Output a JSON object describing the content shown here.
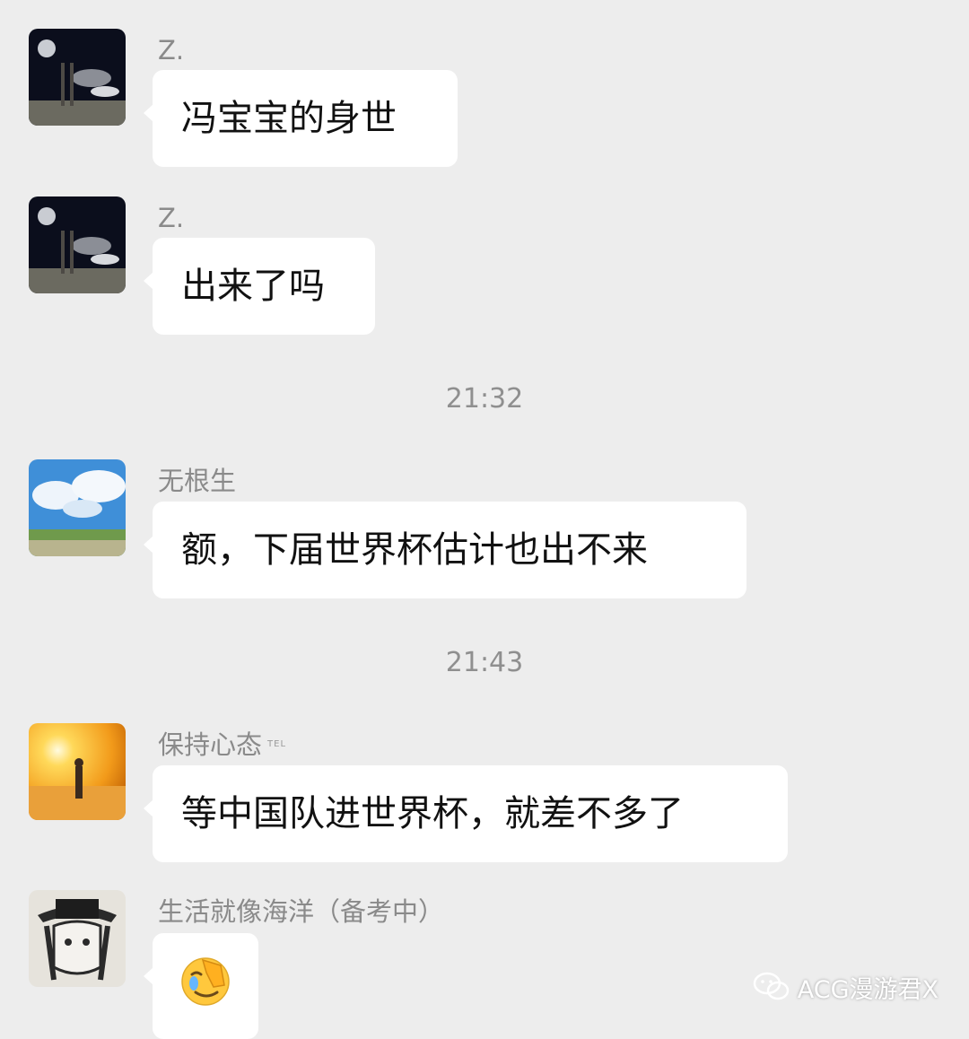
{
  "messages": [
    {
      "sender": "Z.",
      "text": "冯宝宝的身世"
    },
    {
      "sender": "Z.",
      "text": "出来了吗"
    },
    {
      "sender": "无根生",
      "text": "额，下届世界杯估计也出不来"
    },
    {
      "sender": "保持心态",
      "sender_tag": "TEL",
      "text": "等中国队进世界杯，就差不多了"
    },
    {
      "sender": "生活就像海洋（备考中）",
      "emoji": "facepalm-emoji"
    }
  ],
  "timestamps": [
    "21:32",
    "21:43"
  ],
  "watermark": {
    "text": "ACG漫游君X",
    "icon": "wechat-icon"
  },
  "colors": {
    "background": "#ededed",
    "bubble": "#ffffff",
    "meta_text": "#8a8a8a"
  }
}
